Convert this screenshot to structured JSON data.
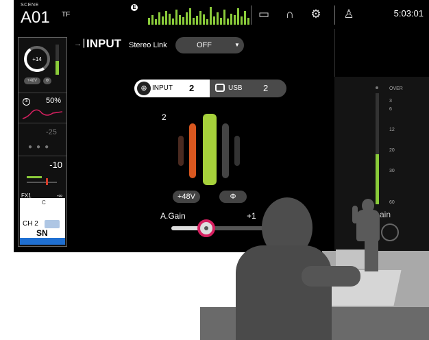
{
  "topbar": {
    "scene_caption": "SCENE",
    "scene_number": "A01",
    "scene_suffix": "TF",
    "meter_badge": "E",
    "time": "5:03:01",
    "icons": [
      "mixer-icon",
      "headphones-icon",
      "gear-icon",
      "user-icon"
    ]
  },
  "channel_strip": {
    "gain_knob_value": "+14",
    "phantom_label": "+48V",
    "phase_label": "Φ",
    "eq_on_label": "①",
    "eq_percent": "50%",
    "dynamics_value": "-25",
    "send_value": "-10",
    "fx_label": "FX1",
    "fx_value": "-∞",
    "pan_label": "C",
    "channel_name": "CH 2",
    "channel_sub": "SN"
  },
  "input": {
    "title": "INPUT",
    "stereo_link_label": "Stereo Link",
    "stereo_link_value": "OFF",
    "source_input_label": "INPUT",
    "source_input_num": "2",
    "source_usb_label": "USB",
    "source_usb_num": "2",
    "gain_visual_label": "2",
    "phantom_button": "+48V",
    "phase_button": "Φ",
    "again_label": "A.Gain",
    "again_value": "+1",
    "again_level": 0.3
  },
  "right_meter": {
    "scale": [
      "OVER",
      "3",
      "6",
      "12",
      "20",
      "30",
      "60"
    ],
    "level": 0.45,
    "gain_label": "ain"
  },
  "colors": {
    "accent_green": "#8acb3a",
    "accent_red": "#d62060",
    "bar_orange": "#d9571f",
    "bar_green": "#a6d13b"
  }
}
